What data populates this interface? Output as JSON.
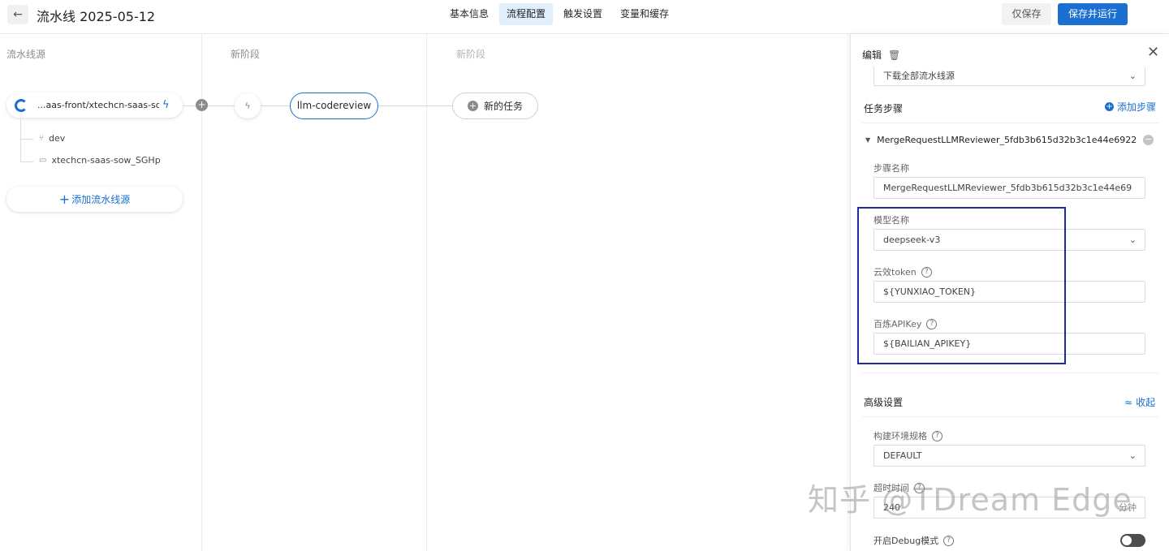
{
  "header": {
    "back_icon": "←",
    "title": "流水线 2025-05-12",
    "tabs": [
      "基本信息",
      "流程配置",
      "触发设置",
      "变量和缓存"
    ],
    "active_tab": "流程配置",
    "save_label": "仅保存",
    "save_run_label": "保存并运行"
  },
  "canvas": {
    "stages": [
      "流水线源",
      "新阶段",
      "新阶段"
    ],
    "source": {
      "name": "...aas-front/xtechcn-saas-sow",
      "branch": "dev",
      "folder": "xtechcn-saas-sow_SGHp"
    },
    "add_source_label": "添加流水线源",
    "job_name": "llm-codereview",
    "new_task_label": "新的任务"
  },
  "panel": {
    "title": "编辑",
    "source_select": "下载全部流水线源",
    "steps_title": "任务步骤",
    "add_step_label": "添加步骤",
    "step_name_header": "MergeRequestLLMReviewer_5fdb3b615d32b3c1e44e6922",
    "fields": {
      "step_name_label": "步骤名称",
      "step_name_value": "MergeRequestLLMReviewer_5fdb3b615d32b3c1e44e69",
      "model_label": "模型名称",
      "model_value": "deepseek-v3",
      "token_label": "云效token",
      "token_value": "${YUNXIAO_TOKEN}",
      "apikey_label": "百炼APIKey",
      "apikey_value": "${BAILIAN_APIKEY}"
    },
    "advanced_title": "高级设置",
    "collapse_label": "收起",
    "env_label": "构建环境规格",
    "env_value": "DEFAULT",
    "timeout_label": "超时时间",
    "timeout_value": "240",
    "timeout_unit": "分钟",
    "debug_label": "开启Debug模式"
  },
  "watermark": "知乎 @TDream Edge",
  "colors": {
    "accent": "#1b6fd1",
    "highlight_box": "#1e2a9e"
  }
}
